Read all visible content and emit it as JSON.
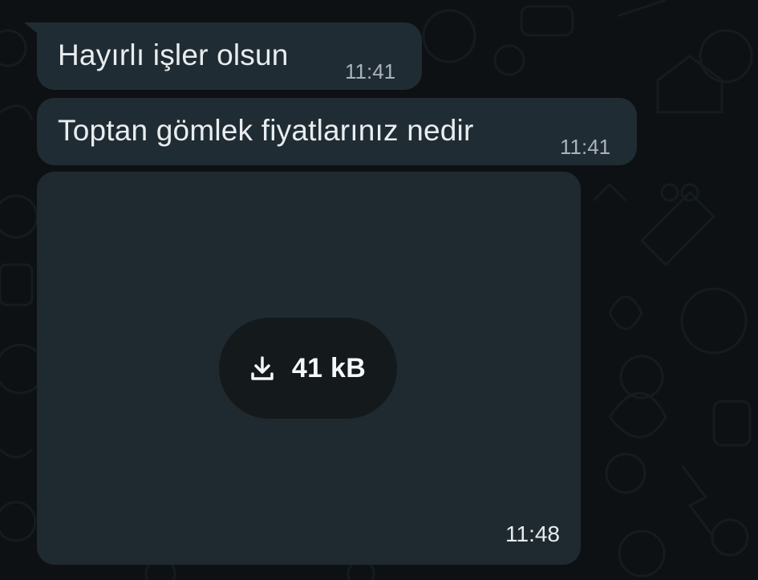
{
  "messages": [
    {
      "text": "Hayırlı işler olsun",
      "time": "11:41"
    },
    {
      "text": "Toptan gömlek fiyatlarınız nedir",
      "time": "11:41"
    }
  ],
  "image_message": {
    "download_size": "41 kB",
    "time": "11:48",
    "download_icon": "download-icon",
    "placeholder_icon": "camera-icon"
  },
  "colors": {
    "background": "#0d1114",
    "bubble": "#202c33",
    "text": "#e9edef",
    "time": "#a9b3b9",
    "download_pill": "#14191c"
  }
}
